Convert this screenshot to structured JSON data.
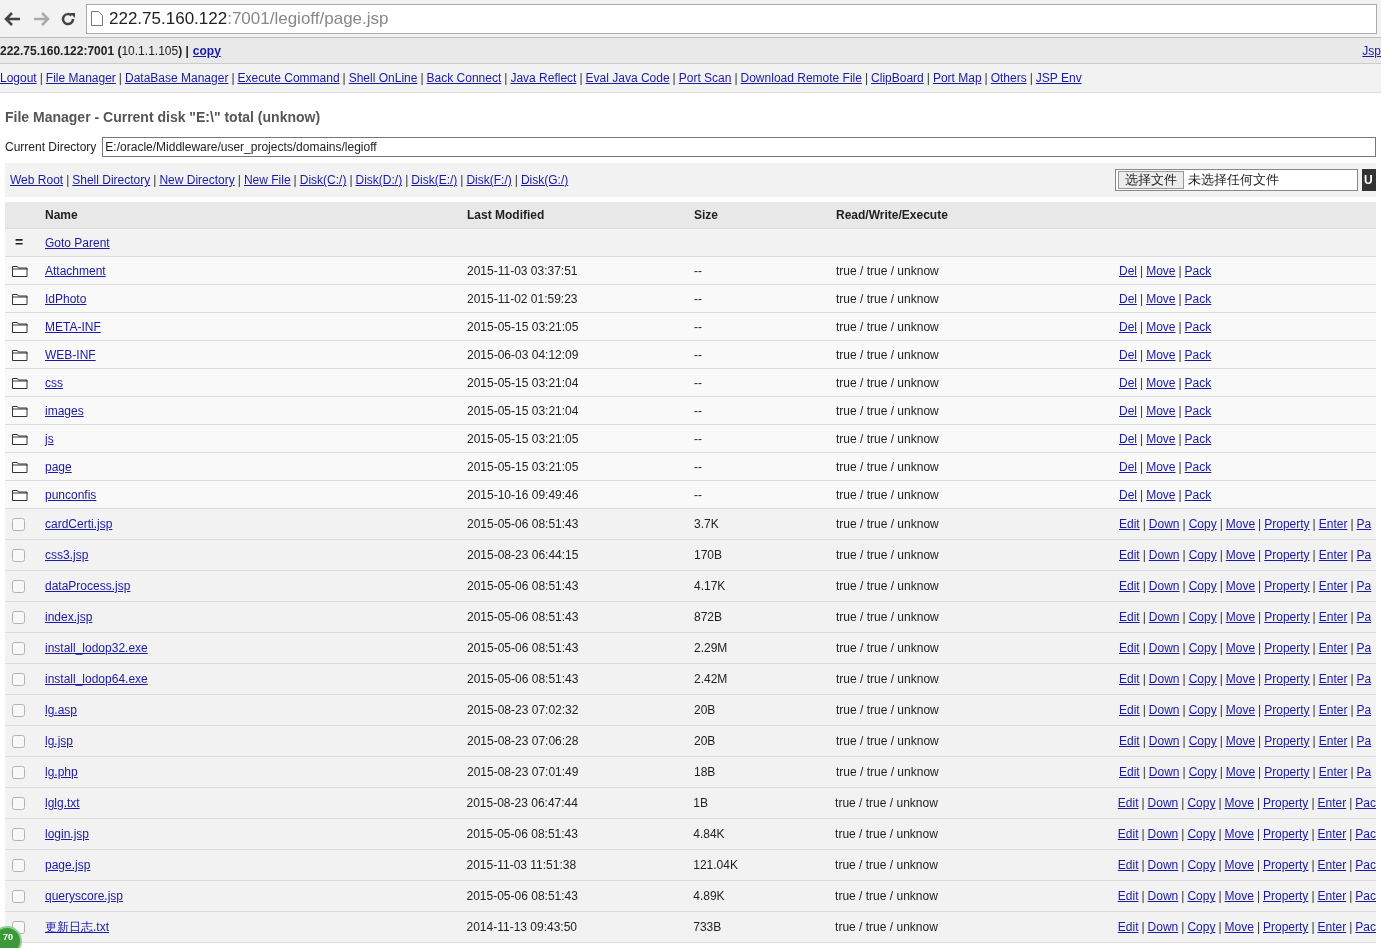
{
  "browser": {
    "url_host": "222.75.160.122",
    "url_rest": ":7001/legioff/page.jsp"
  },
  "header": {
    "server": "**222.75.160.122:7001 (**10.1.1.105**) |**",
    "copy_link": "copy",
    "right_link": "Jsp"
  },
  "separator": "|",
  "nav": [
    "Logout",
    "File Manager",
    "DataBase Manager",
    "Execute Command",
    "Shell OnLine",
    "Back Connect",
    "Java Reflect",
    "Eval Java Code",
    "Port Scan",
    "Download Remote File",
    "ClipBoard",
    "Port Map",
    "Others",
    "JSP Env"
  ],
  "title": "File Manager - Current disk \"E:\\\" total (unknow)",
  "current_directory": {
    "label": "Current Directory",
    "value": "E:/oracle/Middleware/user_projects/domains/legioff"
  },
  "toolbar": [
    "Web Root",
    "Shell Directory",
    "New Directory",
    "New File",
    "Disk(C:/)",
    "Disk(D:/)",
    "Disk(E:/)",
    "Disk(F:/)",
    "Disk(G:/)"
  ],
  "upload": {
    "button": "选择文件",
    "status": "未选择任何文件",
    "submit": "U"
  },
  "table": {
    "columns": [
      "Name",
      "Last Modified",
      "Size",
      "Read/Write/Execute"
    ],
    "parent": {
      "mark": "=",
      "label": "Goto Parent"
    },
    "rows": [
      {
        "kind": "folder",
        "name": "Attachment",
        "modified": "2015-11-03 03:37:51",
        "size": "--",
        "rwx": "true / true / unknow",
        "actions": [
          "Del",
          "Move",
          "Pack"
        ]
      },
      {
        "kind": "folder",
        "name": "IdPhoto",
        "modified": "2015-11-02 01:59:23",
        "size": "--",
        "rwx": "true / true / unknow",
        "actions": [
          "Del",
          "Move",
          "Pack"
        ]
      },
      {
        "kind": "folder",
        "name": "META-INF",
        "modified": "2015-05-15 03:21:05",
        "size": "--",
        "rwx": "true / true / unknow",
        "actions": [
          "Del",
          "Move",
          "Pack"
        ]
      },
      {
        "kind": "folder",
        "name": "WEB-INF",
        "modified": "2015-06-03 04:12:09",
        "size": "--",
        "rwx": "true / true / unknow",
        "actions": [
          "Del",
          "Move",
          "Pack"
        ]
      },
      {
        "kind": "folder",
        "name": "css",
        "modified": "2015-05-15 03:21:04",
        "size": "--",
        "rwx": "true / true / unknow",
        "actions": [
          "Del",
          "Move",
          "Pack"
        ]
      },
      {
        "kind": "folder",
        "name": "images",
        "modified": "2015-05-15 03:21:04",
        "size": "--",
        "rwx": "true / true / unknow",
        "actions": [
          "Del",
          "Move",
          "Pack"
        ]
      },
      {
        "kind": "folder",
        "name": "js",
        "modified": "2015-05-15 03:21:05",
        "size": "--",
        "rwx": "true / true / unknow",
        "actions": [
          "Del",
          "Move",
          "Pack"
        ]
      },
      {
        "kind": "folder",
        "name": "page",
        "modified": "2015-05-15 03:21:05",
        "size": "--",
        "rwx": "true / true / unknow",
        "actions": [
          "Del",
          "Move",
          "Pack"
        ]
      },
      {
        "kind": "folder",
        "name": "punconfis",
        "modified": "2015-10-16 09:49:46",
        "size": "--",
        "rwx": "true / true / unknow",
        "actions": [
          "Del",
          "Move",
          "Pack"
        ]
      },
      {
        "kind": "file",
        "checked": false,
        "name": "cardCerti.jsp",
        "modified": "2015-05-06 08:51:43",
        "size": "3.7K",
        "rwx": "true / true / unknow",
        "actions": [
          "Edit",
          "Down",
          "Copy",
          "Move",
          "Property",
          "Enter",
          "Pa"
        ]
      },
      {
        "kind": "file",
        "checked": false,
        "name": "css3.jsp",
        "modified": "2015-08-23 06:44:15",
        "size": "170B",
        "rwx": "true / true / unknow",
        "actions": [
          "Edit",
          "Down",
          "Copy",
          "Move",
          "Property",
          "Enter",
          "Pa"
        ]
      },
      {
        "kind": "file",
        "checked": false,
        "name": "dataProcess.jsp",
        "modified": "2015-05-06 08:51:43",
        "size": "4.17K",
        "rwx": "true / true / unknow",
        "actions": [
          "Edit",
          "Down",
          "Copy",
          "Move",
          "Property",
          "Enter",
          "Pa"
        ]
      },
      {
        "kind": "file",
        "checked": false,
        "name": "index.jsp",
        "modified": "2015-05-06 08:51:43",
        "size": "872B",
        "rwx": "true / true / unknow",
        "actions": [
          "Edit",
          "Down",
          "Copy",
          "Move",
          "Property",
          "Enter",
          "Pa"
        ]
      },
      {
        "kind": "file",
        "checked": false,
        "name": "install_lodop32.exe",
        "modified": "2015-05-06 08:51:43",
        "size": "2.29M",
        "rwx": "true / true / unknow",
        "actions": [
          "Edit",
          "Down",
          "Copy",
          "Move",
          "Property",
          "Enter",
          "Pa"
        ]
      },
      {
        "kind": "file",
        "checked": false,
        "name": "install_lodop64.exe",
        "modified": "2015-05-06 08:51:43",
        "size": "2.42M",
        "rwx": "true / true / unknow",
        "actions": [
          "Edit",
          "Down",
          "Copy",
          "Move",
          "Property",
          "Enter",
          "Pa"
        ]
      },
      {
        "kind": "file",
        "checked": false,
        "name": "lg.asp",
        "modified": "2015-08-23 07:02:32",
        "size": "20B",
        "rwx": "true / true / unknow",
        "actions": [
          "Edit",
          "Down",
          "Copy",
          "Move",
          "Property",
          "Enter",
          "Pa"
        ]
      },
      {
        "kind": "file",
        "checked": false,
        "name": "lg.jsp",
        "modified": "2015-08-23 07:06:28",
        "size": "20B",
        "rwx": "true / true / unknow",
        "actions": [
          "Edit",
          "Down",
          "Copy",
          "Move",
          "Property",
          "Enter",
          "Pa"
        ]
      },
      {
        "kind": "file",
        "checked": false,
        "name": "lg.php",
        "modified": "2015-08-23 07:01:49",
        "size": "18B",
        "rwx": "true / true / unknow",
        "actions": [
          "Edit",
          "Down",
          "Copy",
          "Move",
          "Property",
          "Enter",
          "Pa"
        ]
      },
      {
        "kind": "file",
        "checked": false,
        "name": "lglg.txt",
        "modified": "2015-08-23 06:47:44",
        "size": "1B",
        "rwx": "true / true / unknow",
        "actions": [
          "Edit",
          "Down",
          "Copy",
          "Move",
          "Property",
          "Enter",
          "Pac"
        ]
      },
      {
        "kind": "file",
        "checked": false,
        "name": "login.jsp",
        "modified": "2015-05-06 08:51:43",
        "size": "4.84K",
        "rwx": "true / true / unknow",
        "actions": [
          "Edit",
          "Down",
          "Copy",
          "Move",
          "Property",
          "Enter",
          "Pac"
        ]
      },
      {
        "kind": "file",
        "checked": false,
        "name": "page.jsp",
        "modified": "2015-11-03 11:51:38",
        "size": "121.04K",
        "rwx": "true / true / unknow",
        "actions": [
          "Edit",
          "Down",
          "Copy",
          "Move",
          "Property",
          "Enter",
          "Pac"
        ]
      },
      {
        "kind": "file",
        "checked": false,
        "name": "queryscore.jsp",
        "modified": "2015-05-06 08:51:43",
        "size": "4.89K",
        "rwx": "true / true / unknow",
        "actions": [
          "Edit",
          "Down",
          "Copy",
          "Move",
          "Property",
          "Enter",
          "Pac"
        ]
      },
      {
        "kind": "file",
        "checked": false,
        "name": "更新日志.txt",
        "modified": "2014-11-13 09:43:50",
        "size": "733B",
        "rwx": "true / true / unknow",
        "actions": [
          "Edit",
          "Down",
          "Copy",
          "Move",
          "Property",
          "Enter",
          "Pac"
        ]
      }
    ]
  },
  "badge": "70"
}
